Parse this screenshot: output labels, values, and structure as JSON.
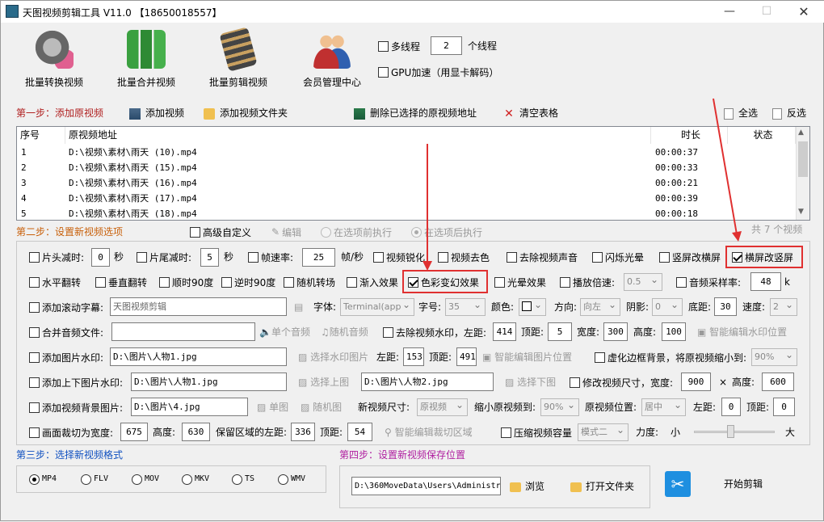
{
  "window": {
    "title": "天图视频剪辑工具 V11.0  【18650018557】",
    "min": "—",
    "max": "☐",
    "close": "✕"
  },
  "toolbar": {
    "buttons": [
      {
        "label": "批量转换视频",
        "icon": "film-reel-icon"
      },
      {
        "label": "批量合并视频",
        "icon": "building-blocks-icon"
      },
      {
        "label": "批量剪辑视频",
        "icon": "film-strip-icon"
      },
      {
        "label": "会员管理中心",
        "icon": "users-icon"
      }
    ],
    "multithread_label": "多线程",
    "threads": "2",
    "threads_suffix": "个线程",
    "gpu_label": "GPU加速（用显卡解码）"
  },
  "step1": {
    "title": "第一步：添加原视频",
    "add_video": "添加视频",
    "add_folder": "添加视频文件夹",
    "delete_selected": "删除已选择的原视频地址",
    "clear": "清空表格",
    "select_all": "全选",
    "invert": "反选",
    "columns": {
      "seq": "序号",
      "path": "原视频地址",
      "duration": "时长",
      "status": "状态"
    },
    "rows": [
      {
        "seq": "1",
        "path": "D:\\视频\\素材\\雨天 (10).mp4",
        "duration": "00:00:37"
      },
      {
        "seq": "2",
        "path": "D:\\视频\\素材\\雨天 (15).mp4",
        "duration": "00:00:33"
      },
      {
        "seq": "3",
        "path": "D:\\视频\\素材\\雨天 (16).mp4",
        "duration": "00:00:21"
      },
      {
        "seq": "4",
        "path": "D:\\视频\\素材\\雨天 (17).mp4",
        "duration": "00:00:39"
      },
      {
        "seq": "5",
        "path": "D:\\视频\\素材\\雨天 (18).mp4",
        "duration": "00:00:18"
      }
    ],
    "total": "共 7 个视频"
  },
  "step2": {
    "title": "第二步：设置新视频选项",
    "advanced": "高级自定义",
    "edit": "编辑",
    "before": "在选项前执行",
    "after": "在选项后执行",
    "row1": {
      "head_cut": "片头减时:",
      "head_val": "0",
      "sec1": "秒",
      "tail_cut": "片尾减时:",
      "tail_val": "5",
      "sec2": "秒",
      "fps": "帧速率:",
      "fps_val": "25",
      "fps_unit": "帧/秒",
      "sharpen": "视频锐化",
      "decolor": "视频去色",
      "remove_audio": "去除视频声音",
      "flash": "闪烁光晕",
      "v2h": "竖屏改横屏",
      "h2v": "横屏改竖屏"
    },
    "row2": {
      "hflip": "水平翻转",
      "vflip": "垂直翻转",
      "rot90": "顺时90度",
      "rot90ccw": "逆时90度",
      "random_trans": "随机转场",
      "fade_in": "渐入效果",
      "color_fx": "色彩变幻效果",
      "light_fx": "光晕效果",
      "speed": "播放倍速:",
      "speed_val": "0.5",
      "sample": "音频采样率:",
      "sample_val": "48",
      "sample_unit": "k"
    },
    "row3": {
      "subtitle": "添加滚动字幕:",
      "subtitle_val": "天图视频剪辑",
      "font": "字体:",
      "font_val": "Terminal(app",
      "size": "字号:",
      "size_val": "35",
      "color": "颜色:",
      "dir": "方向:",
      "dir_val": "向左",
      "shadow": "阴影:",
      "shadow_val": "0",
      "bottom": "底距:",
      "bottom_val": "30",
      "spd": "速度:",
      "spd_val": "2"
    },
    "row4": {
      "merge_audio": "合并音频文件:",
      "single_audio": "单个音频",
      "random_audio": "随机音频",
      "remove_wm": "去除视频水印，左距:",
      "left_val": "414",
      "top": "顶距:",
      "top_val": "5",
      "width": "宽度:",
      "width_val": "300",
      "height": "高度:",
      "height_val": "100",
      "smart_wm": "智能编辑水印位置"
    },
    "row5": {
      "img_wm": "添加图片水印:",
      "img_wm_val": "D:\\图片\\人物1.jpg",
      "choose_wm": "选择水印图片",
      "left": "左距:",
      "left_val": "153",
      "top": "顶距:",
      "top_val": "491",
      "smart_img": "智能编辑图片位置",
      "blur_bg": "虚化边框背景，将原视频缩小到:",
      "blur_val": "90%"
    },
    "row6": {
      "updown": "添加上下图片水印:",
      "up_val": "D:\\图片\\人物1.jpg",
      "choose_up": "选择上图",
      "down_val": "D:\\图片\\人物2.jpg",
      "choose_down": "选择下图",
      "resize": "修改视频尺寸，宽度:",
      "w_val": "900",
      "x": "×",
      "h": "高度:",
      "h_val": "600"
    },
    "row7": {
      "bgimg": "添加视频背景图片:",
      "bgimg_val": "D:\\图片\\4.jpg",
      "single": "单图",
      "random": "随机图",
      "new_size": "新视频尺寸:",
      "new_size_val": "原视频",
      "shrink": "缩小原视频到:",
      "shrink_val": "90%",
      "pos": "原视频位置:",
      "pos_val": "居中",
      "left": "左距:",
      "left_val": "0",
      "top": "顶距:",
      "top_val": "0"
    },
    "row8": {
      "crop": "画面裁切为宽度:",
      "crop_w": "675",
      "crop_h_lbl": "高度:",
      "crop_h": "630",
      "keep_left": "保留区域的左距:",
      "keep_left_val": "336",
      "keep_top": "顶距:",
      "keep_top_val": "54",
      "smart_crop": "智能编辑裁切区域",
      "compress": "压缩视频容量",
      "mode": "模式二",
      "strength": "力度:",
      "small": "小",
      "big": "大"
    }
  },
  "step3": {
    "title": "第三步：选择新视频格式",
    "formats": [
      "MP4",
      "FLV",
      "MOV",
      "MKV",
      "TS",
      "WMV"
    ]
  },
  "step4": {
    "title": "第四步：设置新视频保存位置",
    "path": "D:\\360MoveData\\Users\\Administra",
    "browse": "浏览",
    "open_folder": "打开文件夹",
    "start": "开始剪辑"
  },
  "colors": {
    "step_red": "#b02020",
    "step_orange": "#c8600a",
    "step_blue": "#1050c0",
    "step_magenta": "#b020a0",
    "highlight": "#e03030"
  }
}
